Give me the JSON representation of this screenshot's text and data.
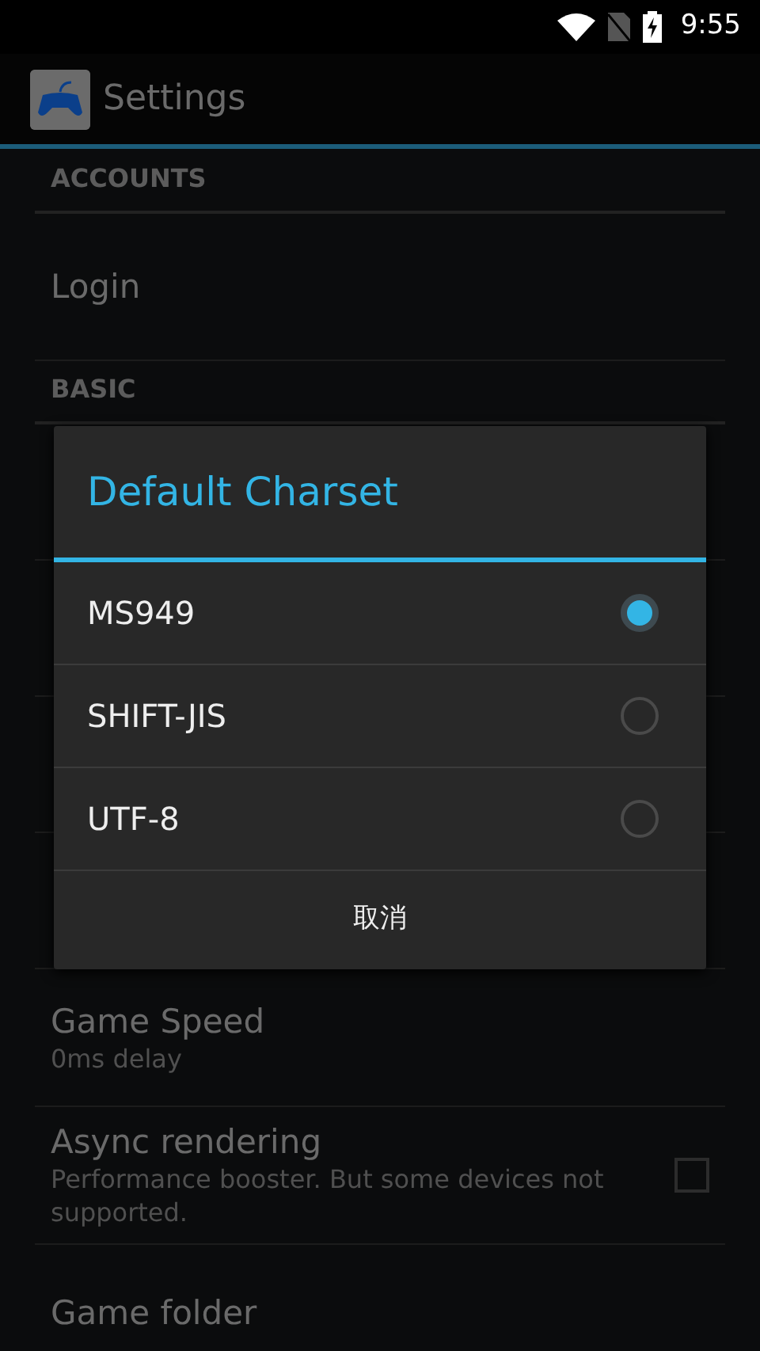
{
  "status_bar": {
    "time": "9:55"
  },
  "app_bar": {
    "title": "Settings"
  },
  "settings": [
    {
      "kind": "header",
      "title": "ACCOUNTS"
    },
    {
      "kind": "item",
      "title": "Login"
    },
    {
      "kind": "header",
      "title": "BASIC"
    },
    {
      "kind": "hidden"
    },
    {
      "kind": "hidden"
    },
    {
      "kind": "hidden"
    },
    {
      "kind": "hidden"
    },
    {
      "kind": "item",
      "title": "Game Speed",
      "summary": "0ms delay"
    },
    {
      "kind": "checkbox",
      "title": "Async rendering",
      "summary": "Performance booster. But some devices not supported.",
      "checked": false
    },
    {
      "kind": "item",
      "title": "Game folder"
    }
  ],
  "dialog": {
    "title": "Default Charset",
    "options": [
      {
        "label": "MS949",
        "selected": true
      },
      {
        "label": "SHIFT-JIS",
        "selected": false
      },
      {
        "label": "UTF-8",
        "selected": false
      }
    ],
    "cancel_button": "取消"
  }
}
